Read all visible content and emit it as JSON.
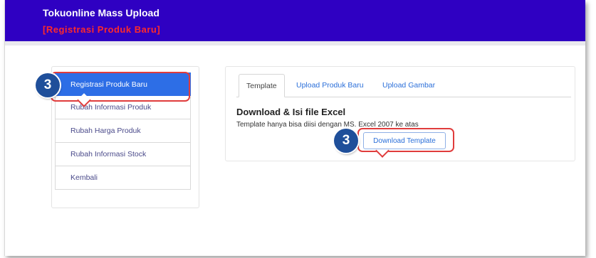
{
  "header": {
    "title": "Tokuonline Mass Upload",
    "subtitle": "[Registrasi Produk Baru]"
  },
  "sidebar": {
    "items": [
      {
        "label": "Registrasi Produk Baru",
        "active": true
      },
      {
        "label": "Rubah Informasi Produk",
        "active": false
      },
      {
        "label": "Rubah Harga Produk",
        "active": false
      },
      {
        "label": "Rubah Informasi Stock",
        "active": false
      },
      {
        "label": "Kembali",
        "active": false
      }
    ]
  },
  "tabs": [
    {
      "label": "Template",
      "active": true
    },
    {
      "label": "Upload Produk Baru",
      "active": false
    },
    {
      "label": "Upload Gambar",
      "active": false
    }
  ],
  "content": {
    "heading": "Download & Isi file Excel",
    "note": "Template hanya bisa diisi dengan MS. Excel 2007 ke atas",
    "download_button": "Download Template"
  },
  "annotations": {
    "step_menu": "3",
    "step_button": "3"
  },
  "colors": {
    "header_bg": "#2f00c2",
    "subtitle": "#ff2a2a",
    "active_item": "#2d6ee6",
    "highlight": "#e03c3c",
    "badge": "#1f4f9a"
  }
}
